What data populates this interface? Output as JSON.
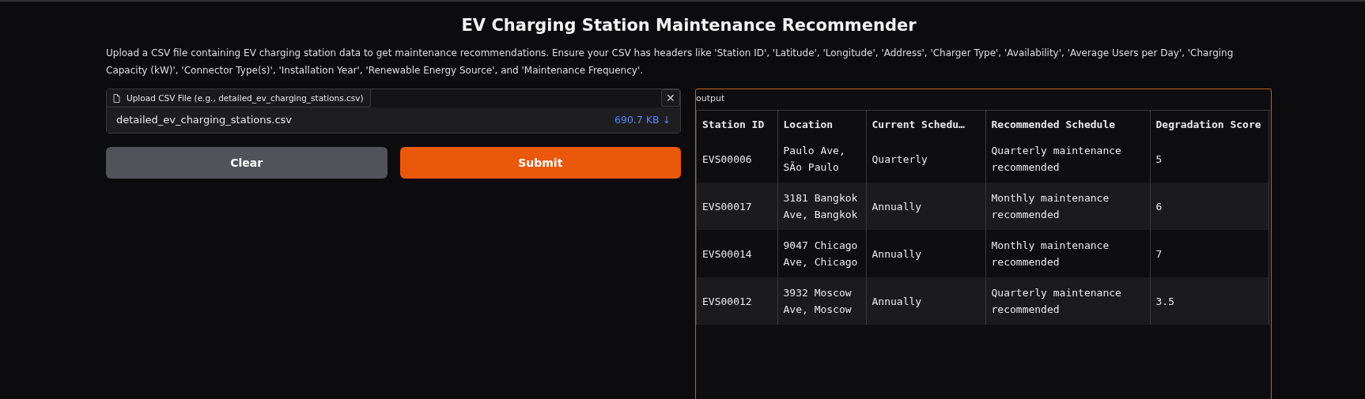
{
  "title": "EV Charging Station Maintenance Recommender",
  "description": "Upload a CSV file containing EV charging station data to get maintenance recommendations. Ensure your CSV has headers like 'Station ID', 'Latitude', 'Longitude', 'Address', 'Charger Type', 'Availability', 'Average Users per Day', 'Charging Capacity (kW)', 'Connector Type(s)', 'Installation Year', 'Renewable Energy Source', and 'Maintenance Frequency'.",
  "upload": {
    "label": "Upload CSV File (e.g., detailed_ev_charging_stations.csv)",
    "file_name": "detailed_ev_charging_stations.csv",
    "file_size": "690.7 KB ↓",
    "close": "✕"
  },
  "buttons": [
    {
      "label": "Clear",
      "kind": "secondary"
    },
    {
      "label": "Submit",
      "kind": "primary"
    }
  ],
  "output": {
    "label": "output",
    "columns": [
      "Station ID",
      "Location",
      "Current Schedu…",
      "Recommended Schedule",
      "Degradation Score"
    ],
    "rows": [
      [
        "EVS00006",
        "Paulo Ave, SÃo Paulo",
        "Quarterly",
        "Quarterly maintenance recommended",
        "5"
      ],
      [
        "EVS00017",
        "3181 Bangkok Ave, Bangkok",
        "Annually",
        "Monthly maintenance recommended",
        "6"
      ],
      [
        "EVS00014",
        "9047 Chicago Ave, Chicago",
        "Annually",
        "Monthly maintenance recommended",
        "7"
      ],
      [
        "EVS00012",
        "3932 Moscow Ave, Moscow",
        "Annually",
        "Quarterly maintenance recommended",
        "3.5"
      ]
    ]
  }
}
